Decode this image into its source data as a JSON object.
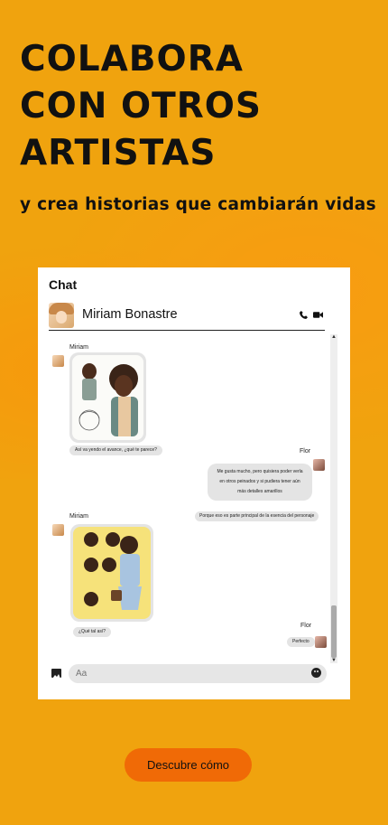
{
  "hero": {
    "title_lines": [
      "COLABORA",
      "CON OTROS",
      "ARTISTAS"
    ],
    "subtitle": "y crea historias que cambiarán vidas"
  },
  "chat": {
    "title": "Chat",
    "contact_name": "Miriam Bonastre",
    "icons": [
      "phone-icon",
      "video-camera-icon"
    ],
    "messages": {
      "m1_sender": "Miriam",
      "m1_text": "Así va yendo el avance, ¿qué te parece?",
      "m2_sender": "Flor",
      "m2_text": "Me gusta mucho, pero quisiera poder verla en otros peinados y si pudiera tener aún más detalles amarillos",
      "m3_text": "Porque eso es parte principal de la esencia del personaje",
      "m4_sender": "Miriam",
      "m4_text": "¿Qué tal así?",
      "m5_sender": "Flor",
      "m5_text": "Perfecto"
    },
    "composer": {
      "placeholder": "Aa",
      "icons": [
        "image-icon",
        "emoji-icon"
      ]
    }
  },
  "cta": {
    "label": "Descubre cómo"
  },
  "colors": {
    "background": "#f0a30e",
    "cta": "#f06a06",
    "bubble": "#e4e4e4"
  }
}
